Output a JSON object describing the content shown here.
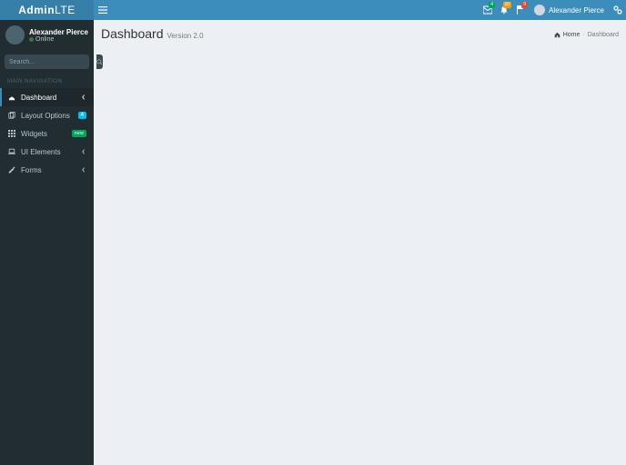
{
  "brand": {
    "bold": "Admin",
    "light": "LTE"
  },
  "topnav": {
    "user_name": "Alexander Pierce",
    "badges": {
      "mail": "4",
      "bell": "10",
      "flag": "9"
    }
  },
  "sidebar": {
    "user": {
      "name": "Alexander Pierce",
      "status": "Online"
    },
    "search_placeholder": "Search...",
    "nav_header": "MAIN NAVIGATION",
    "items": [
      {
        "label": "Dashboard",
        "icon": "dashboard",
        "right": "chevron",
        "active": true
      },
      {
        "label": "Layout Options",
        "icon": "files",
        "right": "badge",
        "badge": "4",
        "badge_cls": "bg-info"
      },
      {
        "label": "Widgets",
        "icon": "th",
        "right": "label",
        "badge": "new"
      },
      {
        "label": "UI Elements",
        "icon": "laptop",
        "right": "chevron"
      },
      {
        "label": "Forms",
        "icon": "edit",
        "right": "chevron"
      }
    ]
  },
  "page": {
    "title": "Dashboard",
    "subtitle": "Version 2.0",
    "breadcrumbs": {
      "home": "Home",
      "current": "Dashboard"
    }
  }
}
